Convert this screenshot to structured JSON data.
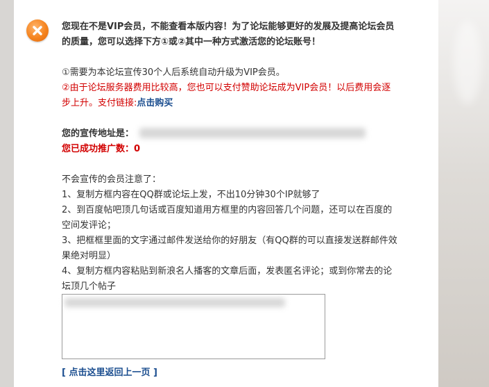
{
  "notice": {
    "headline_1": "您现在不是VIP会员，不能查看本版内容！为了论坛能够更好的发展及提高论坛会员",
    "headline_2": "的质量，您可以选择下方①或②其中一种方式激活您的论坛账号！"
  },
  "options": {
    "option1": "①需要为本论坛宣传30个人后系统自动升级为VIP会员。",
    "option2_line1": "②由于论坛服务器费用比较高，您也可以支付赞助论坛成为VIP会员！以后费用会逐",
    "option2_line2_prefix": "步上升。支付链接:",
    "option2_link": "点击购买"
  },
  "promo": {
    "address_label": "您的宣传地址是：",
    "success_label": "您已成功推广数：",
    "success_count": "0"
  },
  "tips": {
    "heading": "不会宣传的会员注意了：",
    "t1": "1、复制方框内容在QQ群或论坛上发，不出10分钟30个IP就够了",
    "t2_line1": "2、到百度帖吧顶几句话或百度知道用方框里的内容回答几个问题，还可以在百度的",
    "t2_line2": "空间发评论；",
    "t3_line1": "3、把框框里面的文字通过邮件发送给你的好朋友（有QQ群的可以直接发送群邮件效",
    "t3_line2": "果绝对明显）",
    "t4_line1": "4、复制方框内容粘贴到新浪名人播客的文章后面，发表匿名评论；或到你常去的论",
    "t4_line2": "坛顶几个帖子"
  },
  "back_link": "[ 点击这里返回上一页 ]",
  "colors": {
    "icon": "#f5841f",
    "red": "#d20000",
    "link": "#1a4d8f"
  },
  "icon": "close-icon"
}
